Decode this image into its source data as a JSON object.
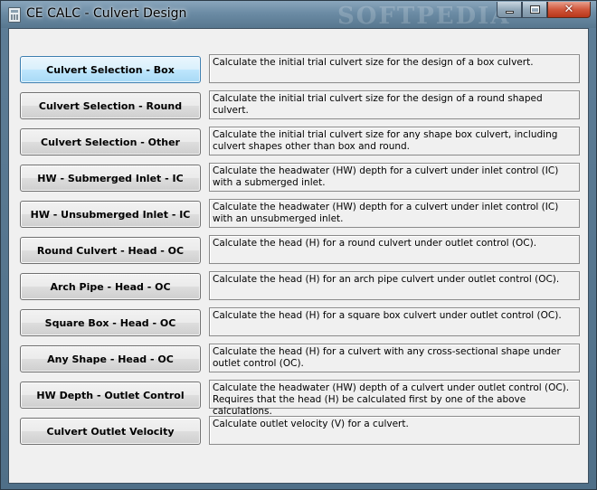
{
  "window": {
    "title": "CE CALC - Culvert Design",
    "watermark": "SOFTPEDIA",
    "controls": {
      "minimize": "minimize",
      "maximize": "maximize",
      "close": "✕"
    }
  },
  "rows": [
    {
      "button": "Culvert Selection - Box",
      "description": "Calculate the initial trial culvert size for the design of a box culvert."
    },
    {
      "button": "Culvert Selection - Round",
      "description": "Calculate the initial trial culvert size for the design of a round shaped culvert."
    },
    {
      "button": "Culvert Selection - Other",
      "description": "Calculate the initial trial culvert size for any shape box culvert, including culvert shapes other than box and round."
    },
    {
      "button": "HW - Submerged Inlet - IC",
      "description": "Calculate the headwater (HW) depth for a culvert under inlet control (IC) with a submerged inlet."
    },
    {
      "button": "HW - Unsubmerged Inlet - IC",
      "description": "Calculate the headwater (HW) depth for a culvert under inlet control (IC) with an unsubmerged inlet."
    },
    {
      "button": "Round Culvert - Head - OC",
      "description": "Calculate the head (H) for a round culvert under outlet control (OC)."
    },
    {
      "button": "Arch Pipe - Head - OC",
      "description": "Calculate the head (H) for an arch pipe culvert under outlet control (OC)."
    },
    {
      "button": "Square Box - Head - OC",
      "description": "Calculate the head (H) for a square box culvert under outlet control (OC)."
    },
    {
      "button": "Any Shape - Head - OC",
      "description": "Calculate the head (H) for a culvert with any cross-sectional shape under outlet control (OC)."
    },
    {
      "button": "HW Depth - Outlet Control",
      "description": "Calculate the headwater (HW) depth of a culvert under outlet control (OC).  Requires that the head (H) be calculated first by one of the above calculations."
    },
    {
      "button": "Culvert Outlet Velocity",
      "description": "Calculate outlet velocity (V) for a culvert."
    }
  ]
}
